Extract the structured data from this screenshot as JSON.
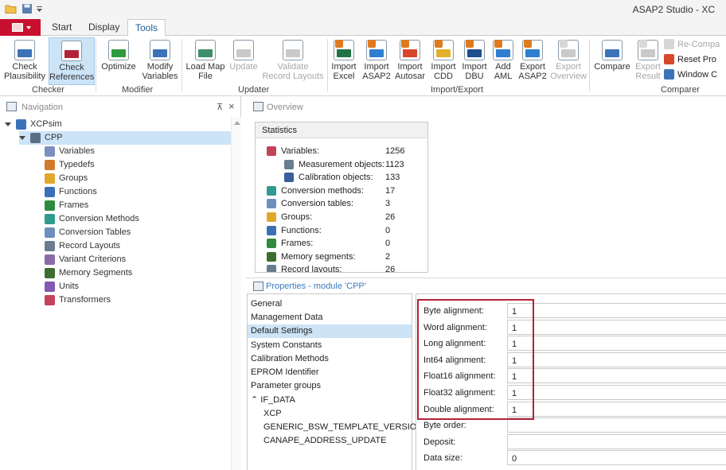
{
  "app": {
    "title": "ASAP2 Studio - XC"
  },
  "quick_access": [
    "open-folder-icon",
    "save-icon",
    "customize-dropdown-icon"
  ],
  "ribbon_tabs": [
    {
      "label": "Start",
      "active": false
    },
    {
      "label": "Display",
      "active": false
    },
    {
      "label": "Tools",
      "active": true
    }
  ],
  "ribbon": {
    "buttons": [
      {
        "id": "check-plausibility",
        "line1": "Check",
        "line2": "Plausibility",
        "icon": "shield-check-icon",
        "color": "#3b73b9",
        "enabled": true,
        "selected": false
      },
      {
        "id": "check-references",
        "line1": "Check",
        "line2": "References",
        "icon": "database-link-icon",
        "color": "#b4223a",
        "enabled": true,
        "selected": true
      },
      {
        "id": "optimize",
        "line1": "Optimize",
        "line2": "",
        "icon": "optimize-icon",
        "color": "#2e9b3e",
        "enabled": true,
        "selected": false
      },
      {
        "id": "modify-variables",
        "line1": "Modify",
        "line2": "Variables",
        "icon": "database-edit-icon",
        "color": "#3b73b9",
        "enabled": true,
        "selected": false
      },
      {
        "id": "load-map-file",
        "line1": "Load Map",
        "line2": "File",
        "icon": "map-file-icon",
        "color": "#3d8f6a",
        "enabled": true,
        "selected": false
      },
      {
        "id": "update",
        "line1": "Update",
        "line2": "",
        "icon": "update-icon",
        "color": "#c9c9c9",
        "enabled": false,
        "selected": false
      },
      {
        "id": "validate-record-layouts",
        "line1": "Validate",
        "line2": "Record Layouts",
        "icon": "validate-icon",
        "color": "#c9c9c9",
        "enabled": false,
        "selected": false
      },
      {
        "id": "import-excel",
        "line1": "Import",
        "line2": "Excel",
        "icon": "import-excel-icon",
        "color": "#217346",
        "enabled": true,
        "selected": false
      },
      {
        "id": "import-asap2",
        "line1": "Import",
        "line2": "ASAP2",
        "icon": "import-a2l-icon",
        "color": "#2f7fd1",
        "enabled": true,
        "selected": false
      },
      {
        "id": "import-autosar",
        "line1": "Import",
        "line2": "Autosar",
        "icon": "import-autosar-icon",
        "color": "#d9472b",
        "enabled": true,
        "selected": false
      },
      {
        "id": "import-cdd",
        "line1": "Import",
        "line2": "CDD",
        "icon": "import-cdd-icon",
        "color": "#e1b12c",
        "enabled": true,
        "selected": false
      },
      {
        "id": "import-dbu",
        "line1": "Import",
        "line2": "DBU",
        "icon": "import-dbu-icon",
        "color": "#1f4e8c",
        "enabled": true,
        "selected": false
      },
      {
        "id": "add-aml",
        "line1": "Add",
        "line2": "AML",
        "icon": "aml-icon",
        "color": "#2f7fd1",
        "enabled": true,
        "selected": false
      },
      {
        "id": "export-asap2",
        "line1": "Export",
        "line2": "ASAP2",
        "icon": "export-a2l-icon",
        "color": "#2f7fd1",
        "enabled": true,
        "selected": false
      },
      {
        "id": "export-overview",
        "line1": "Export",
        "line2": "Overview",
        "icon": "export-overview-icon",
        "color": "#c9c9c9",
        "enabled": false,
        "selected": false
      },
      {
        "id": "compare",
        "line1": "Compare",
        "line2": "",
        "icon": "compare-icon",
        "color": "#3b73b9",
        "enabled": true,
        "selected": false
      },
      {
        "id": "export-result",
        "line1": "Export",
        "line2": "Result",
        "icon": "export-result-icon",
        "color": "#c9c9c9",
        "enabled": false,
        "selected": false
      }
    ],
    "small_buttons": [
      {
        "label": "Re-Compa",
        "icon": "recompare-icon",
        "enabled": false
      },
      {
        "label": "Reset Pro",
        "icon": "reset-icon",
        "enabled": true
      },
      {
        "label": "Window C",
        "icon": "window-icon",
        "enabled": true
      }
    ],
    "groups": [
      "Checker",
      "Modifier",
      "Updater",
      "Import/Export",
      "Comparer"
    ]
  },
  "navigation": {
    "title": "Navigation",
    "pin_glyph": "⊼",
    "close_glyph": "×",
    "tree": [
      {
        "label": "XCPsim",
        "icon": "project-icon",
        "color": "#3b73b9",
        "expanded": true,
        "level": 0,
        "selected": false
      },
      {
        "label": "CPP",
        "icon": "module-icon",
        "color": "#5a6f84",
        "expanded": true,
        "level": 1,
        "selected": true
      },
      {
        "label": "Variables",
        "icon": "variables-icon",
        "color": "#7d8fbf",
        "level": 2
      },
      {
        "label": "Typedefs",
        "icon": "typedefs-icon",
        "color": "#d07a2a",
        "level": 2
      },
      {
        "label": "Groups",
        "icon": "folder-icon",
        "color": "#e0a72c",
        "level": 2
      },
      {
        "label": "Functions",
        "icon": "functions-icon",
        "color": "#3b6fb5",
        "level": 2
      },
      {
        "label": "Frames",
        "icon": "frames-icon",
        "color": "#2e8b3e",
        "level": 2
      },
      {
        "label": "Conversion Methods",
        "icon": "conversion-methods-icon",
        "color": "#2e9b8e",
        "level": 2
      },
      {
        "label": "Conversion Tables",
        "icon": "table-icon",
        "color": "#6d8fbd",
        "level": 2
      },
      {
        "label": "Record Layouts",
        "icon": "record-layouts-icon",
        "color": "#6a7d90",
        "level": 2
      },
      {
        "label": "Variant Criterions",
        "icon": "variant-icon",
        "color": "#8a6aa8",
        "level": 2
      },
      {
        "label": "Memory Segments",
        "icon": "memory-icon",
        "color": "#3c6e2f",
        "level": 2
      },
      {
        "label": "Units",
        "icon": "units-icon",
        "color": "#8457b3",
        "level": 2
      },
      {
        "label": "Transformers",
        "icon": "transformers-icon",
        "color": "#c4425a",
        "level": 2
      }
    ]
  },
  "overview": {
    "title": "Overview",
    "statistics": {
      "title": "Statistics",
      "rows": [
        {
          "label": "Variables:",
          "value": "1256",
          "icon": "variables-wave-icon",
          "color": "#c4425a",
          "indent": false
        },
        {
          "label": "Measurement objects:",
          "value": "1123",
          "icon": "measurement-icon",
          "color": "#6a7d90",
          "indent": true
        },
        {
          "label": "Calibration objects:",
          "value": "133",
          "icon": "calibration-icon",
          "color": "#3b5e9c",
          "indent": true
        },
        {
          "label": "Conversion methods:",
          "value": "17",
          "icon": "conversion-methods-icon",
          "color": "#2e9b8e",
          "indent": false
        },
        {
          "label": "Conversion tables:",
          "value": "3",
          "icon": "table-icon",
          "color": "#6d8fbd",
          "indent": false
        },
        {
          "label": "Groups:",
          "value": "26",
          "icon": "folder-icon",
          "color": "#e0a72c",
          "indent": false
        },
        {
          "label": "Functions:",
          "value": "0",
          "icon": "functions-icon",
          "color": "#3b6fb5",
          "indent": false
        },
        {
          "label": "Frames:",
          "value": "0",
          "icon": "frames-icon",
          "color": "#2e8b3e",
          "indent": false
        },
        {
          "label": "Memory segments:",
          "value": "2",
          "icon": "memory-icon",
          "color": "#3c6e2f",
          "indent": false
        },
        {
          "label": "Record layouts:",
          "value": "26",
          "icon": "record-layouts-icon",
          "color": "#6a7d90",
          "indent": false
        }
      ]
    }
  },
  "properties": {
    "title": "Properties - module 'CPP'",
    "categories": [
      {
        "label": "General",
        "selected": false,
        "indent": false
      },
      {
        "label": "Management Data",
        "selected": false,
        "indent": false
      },
      {
        "label": "Default Settings",
        "selected": true,
        "indent": false
      },
      {
        "label": "System Constants",
        "selected": false,
        "indent": false
      },
      {
        "label": "Calibration Methods",
        "selected": false,
        "indent": false
      },
      {
        "label": "EPROM Identifier",
        "selected": false,
        "indent": false
      },
      {
        "label": "Parameter groups",
        "selected": false,
        "indent": false
      },
      {
        "label": "⌃ IF_DATA",
        "selected": false,
        "indent": false
      },
      {
        "label": "XCP",
        "selected": false,
        "indent": true
      },
      {
        "label": "GENERIC_BSW_TEMPLATE_VERSION",
        "selected": false,
        "indent": true
      },
      {
        "label": "CANAPE_ADDRESS_UPDATE",
        "selected": false,
        "indent": true
      }
    ],
    "fields": [
      {
        "label": "Byte alignment:",
        "value": "1"
      },
      {
        "label": "Word alignment:",
        "value": "1"
      },
      {
        "label": "Long alignment:",
        "value": "1"
      },
      {
        "label": "Int64 alignment:",
        "value": "1"
      },
      {
        "label": "Float16 alignment:",
        "value": "1"
      },
      {
        "label": "Float32 alignment:",
        "value": "1"
      },
      {
        "label": "Double alignment:",
        "value": "1"
      },
      {
        "label": "Byte order:",
        "value": ""
      },
      {
        "label": "Deposit:",
        "value": ""
      },
      {
        "label": "Data size:",
        "value": "0"
      }
    ],
    "highlight_color": "#b4223a"
  }
}
